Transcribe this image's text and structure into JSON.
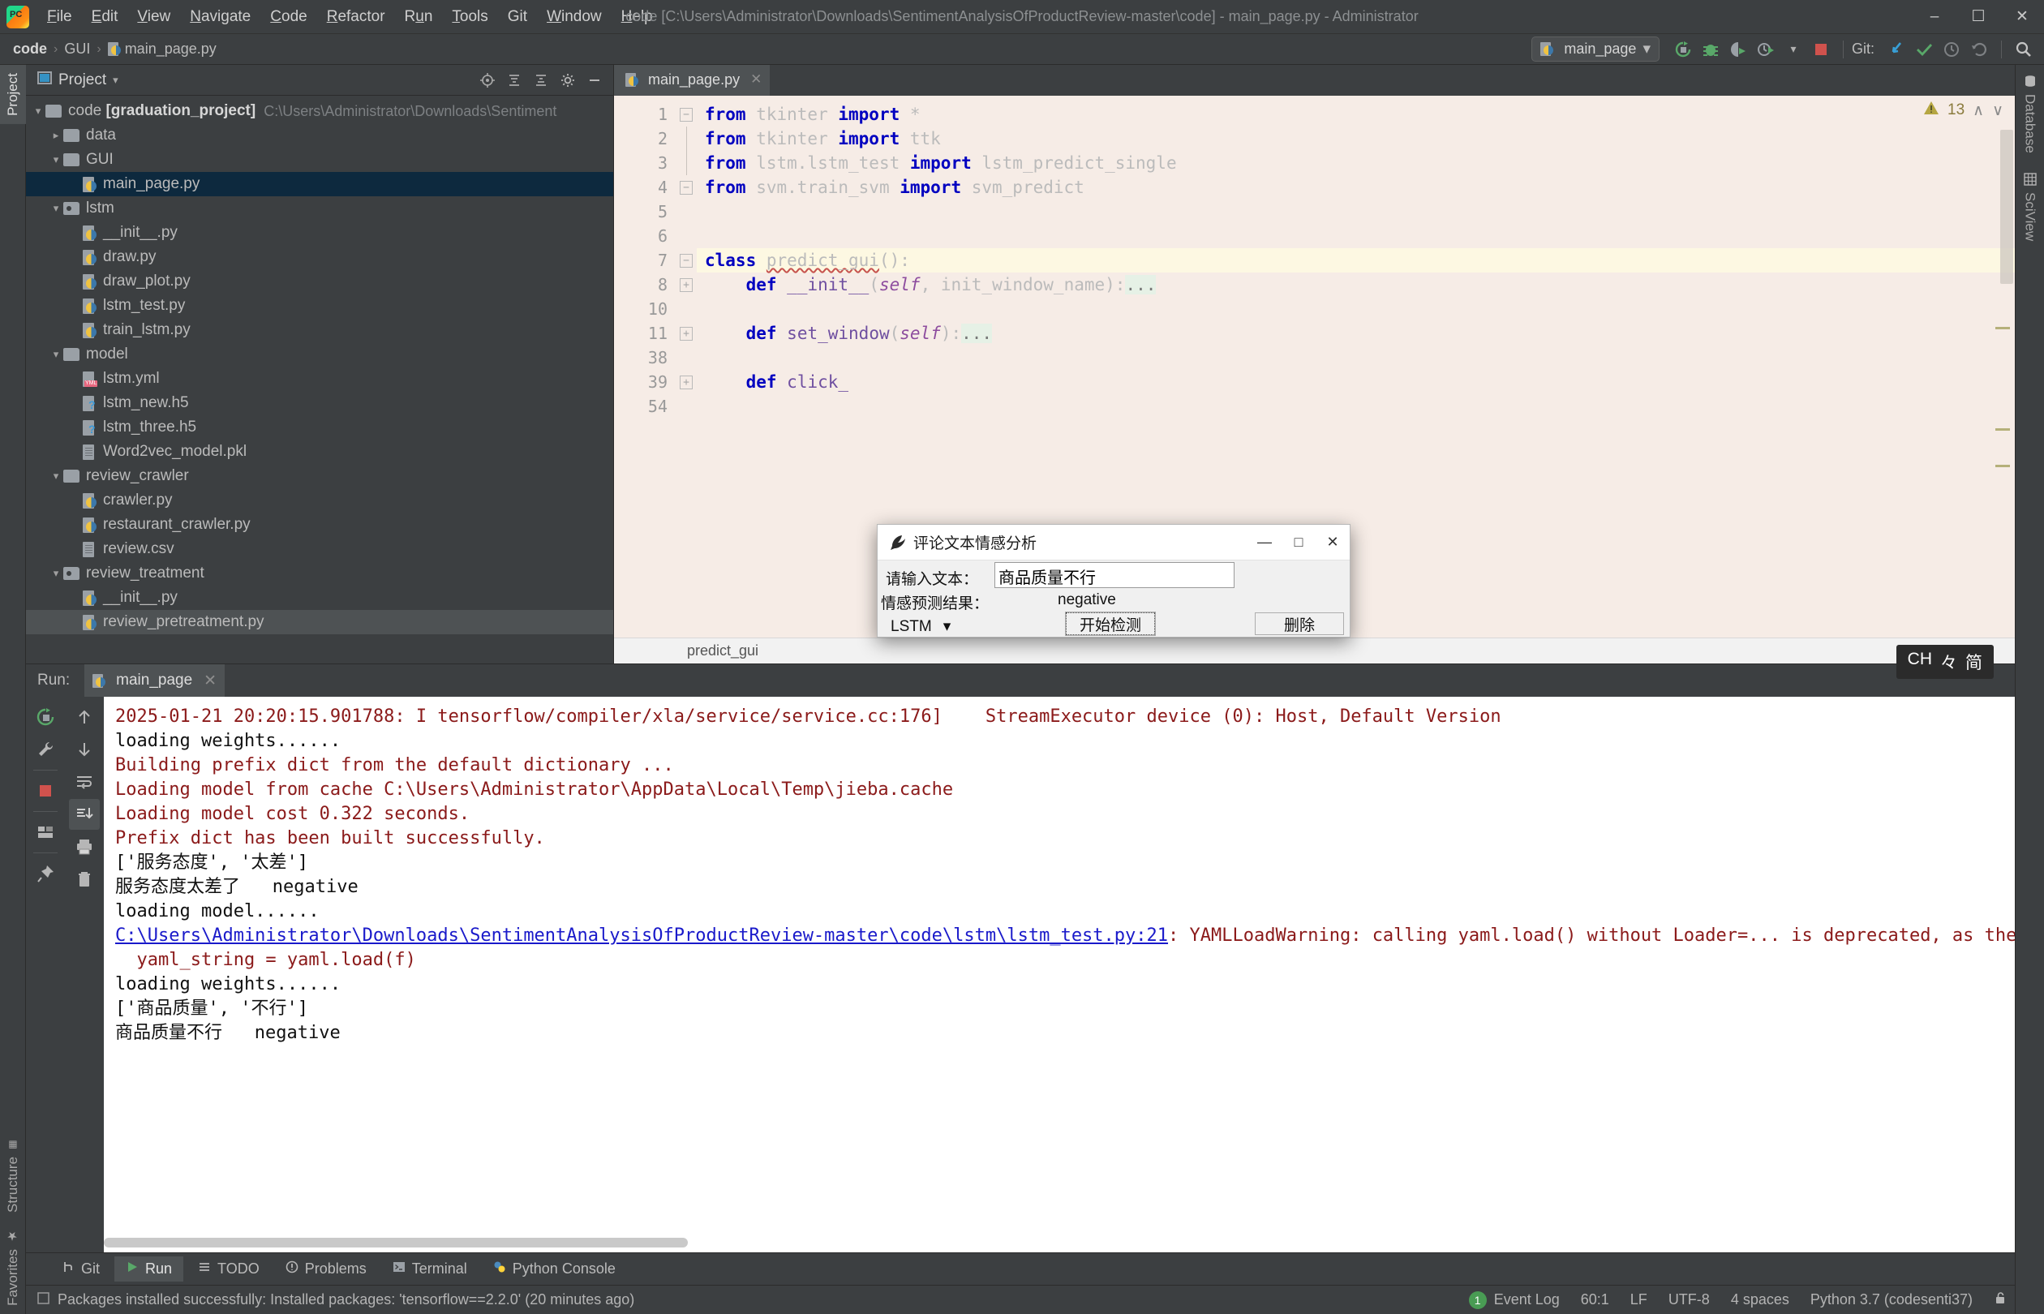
{
  "window": {
    "title": "code [C:\\Users\\Administrator\\Downloads\\SentimentAnalysisOfProductReview-master\\code] - main_page.py - Administrator",
    "minimize": "–",
    "maximize": "☐",
    "close": "✕"
  },
  "menu": [
    "File",
    "Edit",
    "View",
    "Navigate",
    "Code",
    "Refactor",
    "Run",
    "Tools",
    "Git",
    "Window",
    "Help"
  ],
  "breadcrumb": {
    "root": "code",
    "folder": "GUI",
    "file": "main_page.py",
    "separator": "›"
  },
  "toolbar": {
    "run_config": "main_page",
    "chevron": "▾",
    "git_label": "Git:",
    "icons": [
      "rerun-icon",
      "debug-icon",
      "coverage-icon",
      "profile-icon",
      "stop-icon",
      "git-update-icon",
      "git-commit-icon",
      "git-history-icon",
      "git-rollback-icon",
      "search-everywhere-icon"
    ]
  },
  "left_strip": {
    "top_tab": "Project",
    "bottom_tabs": [
      "Structure",
      "Favorites"
    ]
  },
  "right_strip": {
    "tabs": [
      "Database",
      "SciView"
    ]
  },
  "project_panel": {
    "title": "Project",
    "head_icons": [
      "target-icon",
      "collapse-icon",
      "expand-icon",
      "gear-icon",
      "hide-icon"
    ],
    "tree": [
      {
        "level": 0,
        "arrow": "open",
        "icon": "folder",
        "label": "code",
        "bold": "[graduation_project]",
        "path": "C:\\Users\\Administrator\\Downloads\\Sentiment"
      },
      {
        "level": 1,
        "arrow": "closed",
        "icon": "folder",
        "label": "data"
      },
      {
        "level": 1,
        "arrow": "open",
        "icon": "folder",
        "label": "GUI"
      },
      {
        "level": 2,
        "arrow": "none",
        "icon": "py",
        "label": "main_page.py",
        "state": "selected"
      },
      {
        "level": 1,
        "arrow": "open",
        "icon": "folder-src",
        "label": "lstm"
      },
      {
        "level": 2,
        "arrow": "none",
        "icon": "py",
        "label": "__init__.py"
      },
      {
        "level": 2,
        "arrow": "none",
        "icon": "py",
        "label": "draw.py"
      },
      {
        "level": 2,
        "arrow": "none",
        "icon": "py",
        "label": "draw_plot.py"
      },
      {
        "level": 2,
        "arrow": "none",
        "icon": "py",
        "label": "lstm_test.py"
      },
      {
        "level": 2,
        "arrow": "none",
        "icon": "py",
        "label": "train_lstm.py"
      },
      {
        "level": 1,
        "arrow": "open",
        "icon": "folder",
        "label": "model"
      },
      {
        "level": 2,
        "arrow": "none",
        "icon": "yml",
        "label": "lstm.yml"
      },
      {
        "level": 2,
        "arrow": "none",
        "icon": "h5",
        "label": "lstm_new.h5"
      },
      {
        "level": 2,
        "arrow": "none",
        "icon": "h5",
        "label": "lstm_three.h5"
      },
      {
        "level": 2,
        "arrow": "none",
        "icon": "txt",
        "label": "Word2vec_model.pkl"
      },
      {
        "level": 1,
        "arrow": "open",
        "icon": "folder",
        "label": "review_crawler"
      },
      {
        "level": 2,
        "arrow": "none",
        "icon": "py",
        "label": "crawler.py"
      },
      {
        "level": 2,
        "arrow": "none",
        "icon": "py",
        "label": "restaurant_crawler.py"
      },
      {
        "level": 2,
        "arrow": "none",
        "icon": "txt",
        "label": "review.csv"
      },
      {
        "level": 1,
        "arrow": "open",
        "icon": "folder-src",
        "label": "review_treatment"
      },
      {
        "level": 2,
        "arrow": "none",
        "icon": "py",
        "label": "__init__.py"
      },
      {
        "level": 2,
        "arrow": "none",
        "icon": "py",
        "label": "review_pretreatment.py",
        "state": "hovered"
      }
    ]
  },
  "editor": {
    "tab": "main_page.py",
    "tab_close": "✕",
    "warning_count": "13",
    "warning_up": "∧",
    "warning_down": "∨",
    "bottom_breadcrumb": "predict_gui",
    "lines": [
      {
        "num": "1",
        "fold": "minus-top",
        "html": "<span class='kw'>from</span> tkinter <span class='kw'>import</span> *"
      },
      {
        "num": "2",
        "fold": "bar",
        "html": "<span class='kw'>from</span> tkinter <span class='kw'>import</span> ttk"
      },
      {
        "num": "3",
        "fold": "bar",
        "html": "<span class='kw'>from</span> lstm.lstm_test <span class='kw'>import</span> lstm_predict_single"
      },
      {
        "num": "4",
        "fold": "minus-bot",
        "html": "<span class='kw'>from</span> svm.train_svm <span class='kw'>import</span> svm_predict"
      },
      {
        "num": "5",
        "fold": "",
        "html": ""
      },
      {
        "num": "6",
        "fold": "",
        "html": ""
      },
      {
        "num": "7",
        "fold": "minus-top",
        "hl": true,
        "html": "<span class='kw'>class</span> <span class='squig'>predict_gui</span>():"
      },
      {
        "num": "8",
        "fold": "plus",
        "html": "    <span class='kw'>def</span> <span class='fn'>__init__</span>(<span class='self'>self</span>, init_window_name):<span class='dots'>...</span>"
      },
      {
        "num": "10",
        "fold": "",
        "html": ""
      },
      {
        "num": "11",
        "fold": "plus",
        "html": "    <span class='kw'>def</span> <span class='fn'>set_window</span>(<span class='self'>self</span>):<span class='dots'>...</span>"
      },
      {
        "num": "38",
        "fold": "",
        "html": ""
      },
      {
        "num": "39",
        "fold": "plus",
        "html": "    <span class='kw'>def</span> <span class='fn'>click_</span>"
      },
      {
        "num": "54",
        "fold": "",
        "html": ""
      }
    ]
  },
  "run_panel": {
    "label": "Run:",
    "tab": "main_page",
    "tab_close": "✕",
    "tools_left": [
      "rerun-icon",
      "settings-wrench-icon",
      "stop-icon",
      "layout-icon",
      "pin-icon"
    ],
    "tools_right": [
      "up-arrow-icon",
      "down-arrow-icon",
      "soft-wrap-icon",
      "scroll-to-end-icon",
      "print-icon",
      "trash-icon"
    ],
    "console_lines": [
      {
        "t": "2025-01-21 20:20:15.901788: I tensorflow/compiler/xla/service/service.cc:176]    StreamExecutor device (0): Host, Default Version",
        "c": "red"
      },
      {
        "t": "loading weights......",
        "c": "black"
      },
      {
        "t": "Building prefix dict from the default dictionary ...",
        "c": "red"
      },
      {
        "t": "Loading model from cache C:\\Users\\Administrator\\AppData\\Local\\Temp\\jieba.cache",
        "c": "red"
      },
      {
        "t": "Loading model cost 0.322 seconds.",
        "c": "red"
      },
      {
        "t": "Prefix dict has been built successfully.",
        "c": "red"
      },
      {
        "t": "['服务态度', '太差']",
        "c": "black"
      },
      {
        "t": "服务态度太差了   negative",
        "c": "black"
      },
      {
        "t": "loading model......",
        "c": "black"
      },
      {
        "link": "C:\\Users\\Administrator\\Downloads\\SentimentAnalysisOfProductReview-master\\code\\lstm\\lstm_test.py:21",
        "t": ": YAMLLoadWarning: calling yaml.load() without Loader=... is deprecated, as the default Loader is unsafe.",
        "c": "red"
      },
      {
        "t": "  yaml_string = yaml.load(f)",
        "c": "red"
      },
      {
        "t": "loading weights......",
        "c": "black"
      },
      {
        "t": "['商品质量', '不行']",
        "c": "black"
      },
      {
        "t": "商品质量不行   negative",
        "c": "black"
      }
    ]
  },
  "tool_windows": [
    {
      "label": "Git",
      "icon": "git-icon",
      "active": false
    },
    {
      "label": "Run",
      "icon": "run-icon",
      "active": true
    },
    {
      "label": "TODO",
      "icon": "todo-icon",
      "active": false
    },
    {
      "label": "Problems",
      "icon": "problems-icon",
      "active": false
    },
    {
      "label": "Terminal",
      "icon": "terminal-icon",
      "active": false
    },
    {
      "label": "Python Console",
      "icon": "python-console-icon",
      "active": false
    }
  ],
  "statusbar": {
    "message": "Packages installed successfully: Installed packages: 'tensorflow==2.2.0' (20 minutes ago)",
    "event_log": "Event Log",
    "event_count": "1",
    "caret": "60:1",
    "line_sep": "LF",
    "encoding": "UTF-8",
    "indent": "4 spaces",
    "interpreter": "Python 3.7 (codesenti37)",
    "lock_icon": "unlocked-icon"
  },
  "tk_dialog": {
    "title": "评论文本情感分析",
    "minimize": "—",
    "maximize": "□",
    "close": "✕",
    "input_label": "请输入文本：",
    "input_value": "商品质量不行",
    "result_label": "情感预测结果：",
    "result_value": "negative",
    "model_select": "LSTM",
    "model_chevron": "▾",
    "detect_button": "开始检测",
    "delete_button": "删除"
  },
  "ime": {
    "lang": "CH",
    "mode": "々",
    "shape": "简"
  },
  "colors": {
    "ide_bg": "#3c3f41",
    "editor_bg": "#f6ece6",
    "selection": "#0d293e",
    "console_red": "#8b1a1a",
    "link_blue": "#1a1aca",
    "accent_green": "#499c54"
  }
}
